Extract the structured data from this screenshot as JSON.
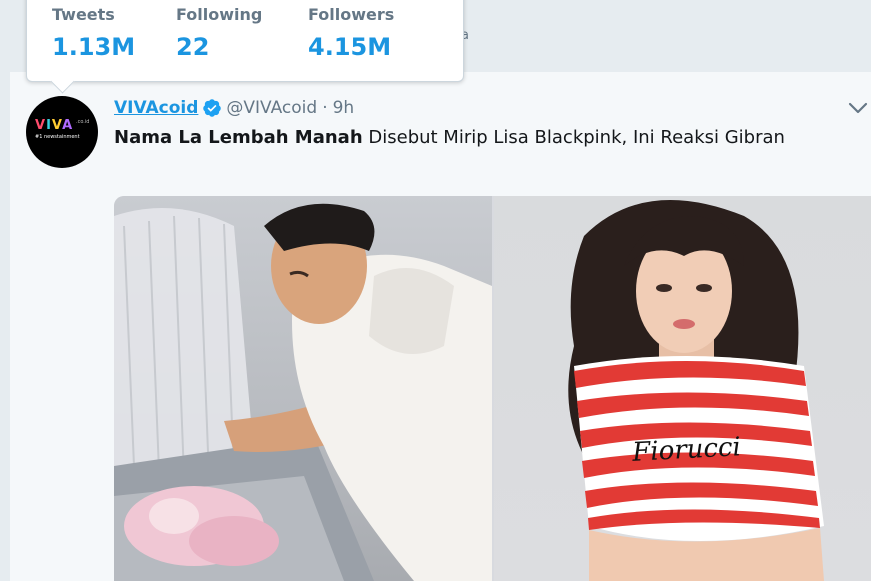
{
  "hovercard": {
    "stats": [
      {
        "label": "Tweets",
        "value": "1.13M"
      },
      {
        "label": "Following",
        "value": "22"
      },
      {
        "label": "Followers",
        "value": "4.15M"
      }
    ]
  },
  "tweet": {
    "author_name": "VIVAcoid",
    "handle": "@VIVAcoid",
    "separator": "·",
    "time": "9h",
    "text_bold": "Nama La Lembah Manah",
    "text_rest": " Disebut Mirip Lisa Blackpink, Ini Reaksi Gibran",
    "avatar": {
      "logo_v": "V",
      "logo_i": "I",
      "logo_v2": "V",
      "logo_a": "A",
      "logo_suffix": ".co.id",
      "tagline": "#1 newstainment"
    },
    "media": {
      "left_shirt_text": "",
      "right_shirt_text": "Fiorucci"
    }
  },
  "colors": {
    "accent": "#1b95e0",
    "secondary_text": "#657786",
    "primary_text": "#14171a",
    "card_background": "#f5f8fa"
  },
  "icons": {
    "verified": "verified-badge-icon",
    "chevron": "chevron-down-icon"
  }
}
